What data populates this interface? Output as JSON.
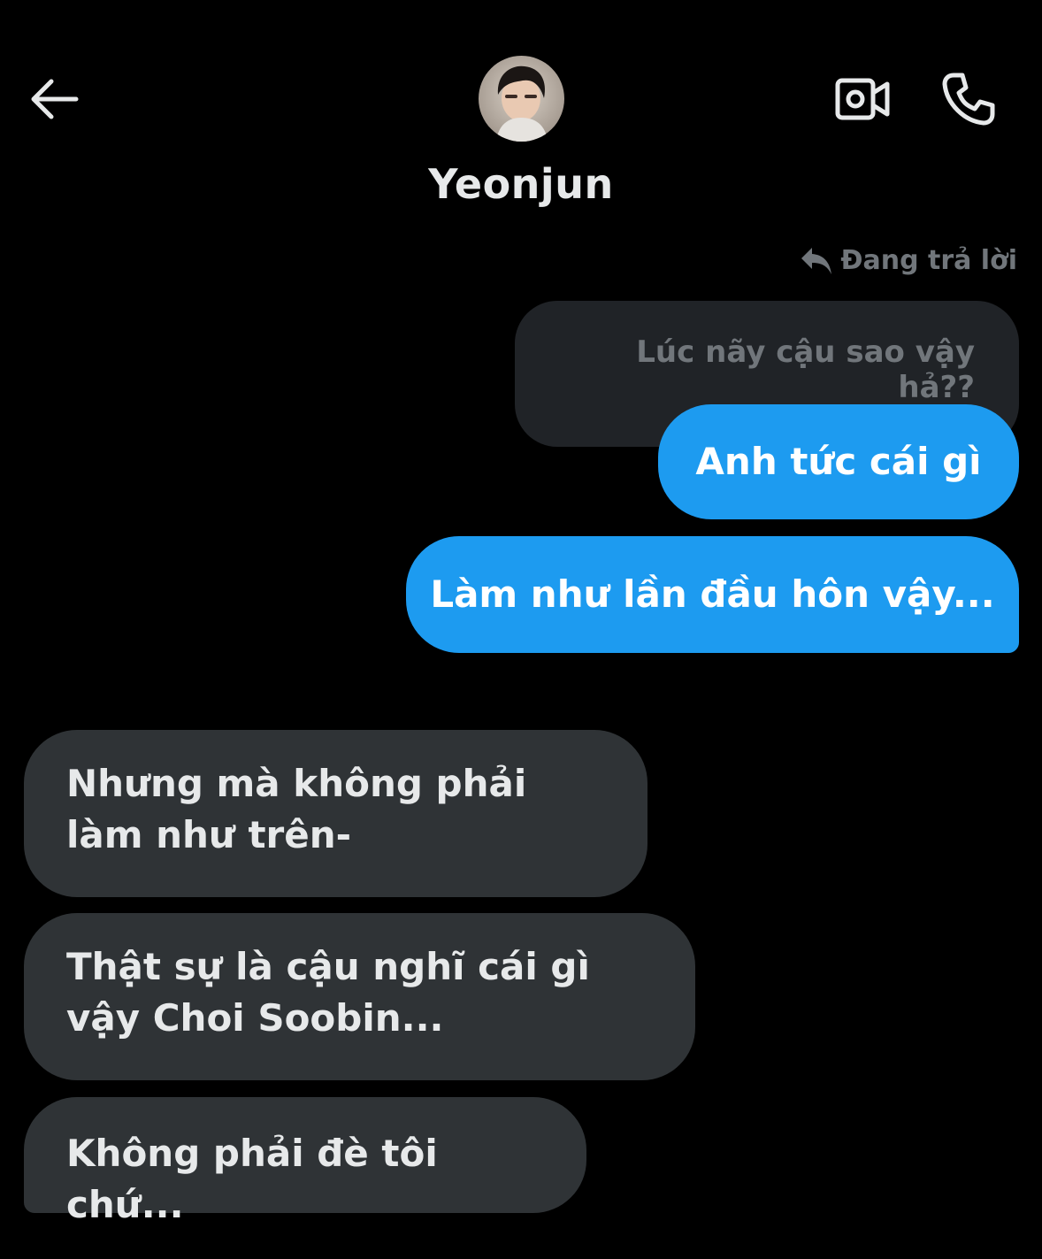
{
  "header": {
    "contact_name": "Yeonjun",
    "back_icon": "arrow-left-icon",
    "video_icon": "video-camera-icon",
    "call_icon": "phone-icon"
  },
  "reply": {
    "indicator_label": "Đang trả lời",
    "quoted_text": "Lúc nãy cậu sao vậy hả??"
  },
  "messages": {
    "sent": [
      "Anh tức cái gì",
      "Làm như lần đầu hôn vậy..."
    ],
    "received": [
      "Nhưng mà không phải làm như trên-",
      "Thật sự là cậu nghĩ cái gì vậy Choi Soobin...",
      "Không phải đè tôi chứ..."
    ]
  },
  "colors": {
    "background": "#000000",
    "sent_bubble": "#1d9bf0",
    "received_bubble": "#2f3336",
    "muted_text": "#71767b"
  }
}
